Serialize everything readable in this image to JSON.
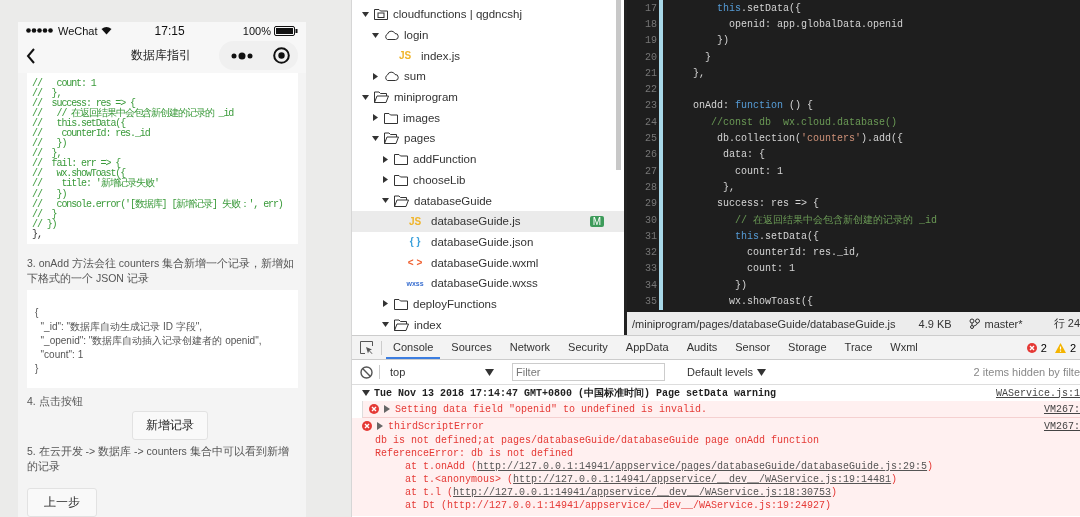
{
  "phone": {
    "status_bar": {
      "carrier": "WeChat",
      "time": "17:15",
      "battery": "100%"
    },
    "nav": {
      "title": "数据库指引"
    },
    "code_lines": [
      {
        "text": "//   count: 1",
        "kind": "comment"
      },
      {
        "text": "//  },",
        "kind": "comment"
      },
      {
        "text": "//  success: res => {",
        "kind": "comment"
      },
      {
        "text": "//   // 在返回结果中会包含新创建的记录的 _id",
        "kind": "comment"
      },
      {
        "text": "//   this.setData({",
        "kind": "comment"
      },
      {
        "text": "//    counterId: res._id",
        "kind": "comment"
      },
      {
        "text": "//   })",
        "kind": "comment"
      },
      {
        "text": "//  },",
        "kind": "comment"
      },
      {
        "text": "//  fail: err => {",
        "kind": "comment"
      },
      {
        "text": "//   wx.showToast({",
        "kind": "comment"
      },
      {
        "text": "//    title: '新增记录失败'",
        "kind": "comment"
      },
      {
        "text": "//   })",
        "kind": "comment"
      },
      {
        "text": "//   console.error('[数据库] [新增记录] 失败：', err)",
        "kind": "comment"
      },
      {
        "text": "//  }",
        "kind": "comment"
      },
      {
        "text": "// })",
        "kind": "comment"
      },
      {
        "text": "},",
        "kind": "plain"
      }
    ],
    "step3": "3. onAdd 方法会往 counters 集合新增一个记录，新增如下格式的一个 JSON 记录",
    "json_lines": [
      "{",
      "  \"_id\": \"数据库自动生成记录 ID 字段\",",
      "  \"_openid\": \"数据库自动插入记录创建者的 openid\",",
      "  \"count\": 1",
      "}"
    ],
    "step4": "4. 点击按钮",
    "add_button": "新增记录",
    "step5": "5. 在云开发 -> 数据库 -> counters 集合中可以看到新增的记录",
    "prev_button": "上一步"
  },
  "file_tree": [
    {
      "label": "cloudfunctions | qgdncshj",
      "kind": "project",
      "expanded": true,
      "selected": false,
      "children": [
        {
          "label": "login",
          "kind": "cloud",
          "expanded": true,
          "selected": false,
          "children": [
            {
              "label": "index.js",
              "kind": "js",
              "icon": "JS",
              "selected": false
            }
          ]
        },
        {
          "label": "sum",
          "kind": "cloud",
          "expanded": false,
          "selected": false
        }
      ]
    },
    {
      "label": "miniprogram",
      "kind": "folder",
      "expanded": true,
      "selected": false,
      "children": [
        {
          "label": "images",
          "kind": "folder",
          "expanded": false,
          "selected": false
        },
        {
          "label": "pages",
          "kind": "folder",
          "expanded": true,
          "selected": false,
          "children": [
            {
              "label": "addFunction",
              "kind": "folder",
              "expanded": false,
              "selected": false
            },
            {
              "label": "chooseLib",
              "kind": "folder",
              "expanded": false,
              "selected": false
            },
            {
              "label": "databaseGuide",
              "kind": "folder",
              "expanded": true,
              "selected": false,
              "children": [
                {
                  "label": "databaseGuide.js",
                  "kind": "js",
                  "icon": "JS",
                  "selected": true,
                  "badge": "M"
                },
                {
                  "label": "databaseGuide.json",
                  "kind": "json",
                  "icon": "{ }",
                  "selected": false
                },
                {
                  "label": "databaseGuide.wxml",
                  "kind": "wxml",
                  "icon": "< >",
                  "selected": false
                },
                {
                  "label": "databaseGuide.wxss",
                  "kind": "wxss",
                  "icon": "wxss",
                  "selected": false
                }
              ]
            },
            {
              "label": "deployFunctions",
              "kind": "folder",
              "expanded": false,
              "selected": false
            },
            {
              "label": "index",
              "kind": "folder",
              "expanded": true,
              "selected": false
            }
          ]
        }
      ]
    }
  ],
  "editor": {
    "lines": [
      {
        "number": "17",
        "tokens": [
          {
            "t": "        this",
            "kind": "keyword"
          },
          {
            "t": ".setData({",
            "kind": "plain"
          }
        ]
      },
      {
        "number": "18",
        "tokens": [
          {
            "t": "          openid: app.globalData.openid",
            "kind": "plain"
          }
        ]
      },
      {
        "number": "19",
        "tokens": [
          {
            "t": "        })",
            "kind": "plain"
          }
        ]
      },
      {
        "number": "20",
        "tokens": [
          {
            "t": "      }",
            "kind": "plain"
          }
        ]
      },
      {
        "number": "21",
        "tokens": [
          {
            "t": "    },",
            "kind": "plain"
          }
        ]
      },
      {
        "number": "22"
      },
      {
        "number": "23",
        "tokens": [
          {
            "t": "    onAdd: ",
            "kind": "plain"
          },
          {
            "t": "function",
            "kind": "keyword"
          },
          {
            "t": " () {",
            "kind": "plain"
          }
        ]
      },
      {
        "number": "24",
        "tokens": [
          {
            "t": "       //const db  wx.cloud.database()",
            "kind": "comment"
          }
        ]
      },
      {
        "number": "25",
        "tokens": [
          {
            "t": "        db.collection(",
            "kind": "plain"
          },
          {
            "t": "'counters'",
            "kind": "string"
          },
          {
            "t": ").add({",
            "kind": "plain"
          }
        ]
      },
      {
        "number": "26",
        "tokens": [
          {
            "t": "         data: {",
            "kind": "plain"
          }
        ]
      },
      {
        "number": "27",
        "tokens": [
          {
            "t": "           count: 1",
            "kind": "plain"
          }
        ]
      },
      {
        "number": "28",
        "tokens": [
          {
            "t": "         },",
            "kind": "plain"
          }
        ]
      },
      {
        "number": "29",
        "tokens": [
          {
            "t": "        success: res => {",
            "kind": "plain"
          }
        ]
      },
      {
        "number": "30",
        "tokens": [
          {
            "t": "           // 在返回结果中会包含新创建的记录的 _id",
            "kind": "comment"
          }
        ]
      },
      {
        "number": "31",
        "tokens": [
          {
            "t": "           this",
            "kind": "keyword"
          },
          {
            "t": ".setData({",
            "kind": "plain"
          }
        ]
      },
      {
        "number": "32",
        "tokens": [
          {
            "t": "             counterId: res._id,",
            "kind": "plain"
          }
        ]
      },
      {
        "number": "33",
        "tokens": [
          {
            "t": "             count: 1",
            "kind": "plain"
          }
        ]
      },
      {
        "number": "34",
        "tokens": [
          {
            "t": "           })",
            "kind": "plain"
          }
        ]
      },
      {
        "number": "35",
        "tokens": [
          {
            "t": "          wx.showToast({",
            "kind": "plain"
          }
        ]
      }
    ],
    "status": {
      "path": "/miniprogram/pages/databaseGuide/databaseGuide.js",
      "size": "4.9 KB",
      "branch": "master*",
      "position": "行 24"
    }
  },
  "console": {
    "tabs": [
      {
        "label": "Console",
        "selected": true
      },
      {
        "label": "Sources",
        "selected": false
      },
      {
        "label": "Network",
        "selected": false
      },
      {
        "label": "Security",
        "selected": false
      },
      {
        "label": "AppData",
        "selected": false
      },
      {
        "label": "Audits",
        "selected": false
      },
      {
        "label": "Sensor",
        "selected": false
      },
      {
        "label": "Storage",
        "selected": false
      },
      {
        "label": "Trace",
        "selected": false
      },
      {
        "label": "Wxml",
        "selected": false
      }
    ],
    "error_count": "2",
    "warning_count": "2",
    "context": "top",
    "filter_placeholder": "Filter",
    "levels": "Default levels",
    "hidden_note": "2 items hidden by filte",
    "messages": [
      {
        "kind": "group",
        "expanded": true,
        "text": "Tue Nov 13 2018 17:14:47 GMT+0800 (中国标准时间) Page setData warning",
        "source": "WAService.js:1",
        "children": [
          {
            "kind": "error",
            "expanded": false,
            "text": "Setting data field \"openid\" to undefined is invalid.",
            "source": "VM267:"
          }
        ]
      },
      {
        "kind": "error",
        "expanded": false,
        "text": "thirdScriptError",
        "source": "VM267:",
        "details": [
          {
            "kind": "text",
            "text": "db is not defined;at pages/databaseGuide/databaseGuide page onAdd function"
          },
          {
            "kind": "text",
            "text": "ReferenceError: db is not defined"
          },
          {
            "kind": "frame",
            "prefix": "at t.onAdd (",
            "link": "http://127.0.0.1:14941/appservice/pages/databaseGuide/databaseGuide.js:29:5",
            "suffix": ")"
          },
          {
            "kind": "frame",
            "prefix": "at t.<anonymous> (",
            "link": "http://127.0.0.1:14941/appservice/__dev__/WAService.js:19:14481",
            "suffix": ")"
          },
          {
            "kind": "frame",
            "prefix": "at t.l (",
            "link": "http://127.0.0.1:14941/appservice/__dev__/WAService.js:18:30753",
            "suffix": ")"
          },
          {
            "kind": "stack",
            "text": "at Dt (http://127.0.0.1:14941/appservice/__dev__/WAService.js:19:24927)"
          }
        ]
      }
    ]
  }
}
